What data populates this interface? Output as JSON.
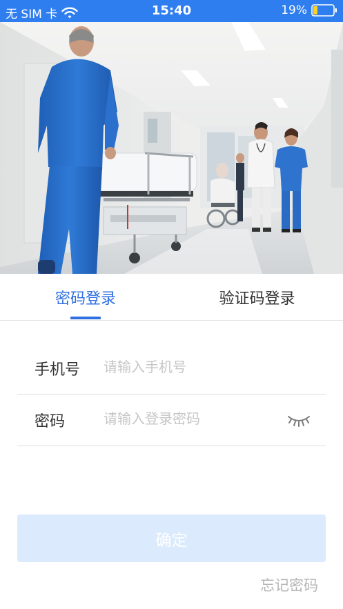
{
  "status_bar": {
    "carrier": "无 SIM 卡",
    "time": "15:40",
    "battery": "19%",
    "icons": [
      "wifi-icon",
      "battery-icon"
    ],
    "color": "#2f7ef0"
  },
  "hero": {
    "icon": "hospital-corridor-photo"
  },
  "tabs": {
    "password_login": "密码登录",
    "code_login": "验证码登录",
    "active": "password_login",
    "accent_color": "#2f6fe0"
  },
  "form": {
    "phone": {
      "label": "手机号",
      "placeholder": "请输入手机号",
      "value": ""
    },
    "password": {
      "label": "密码",
      "placeholder": "请输入登录密码",
      "value": "",
      "toggle_icon": "eye-closed-icon"
    }
  },
  "confirm_button": {
    "label": "确定",
    "background": "#dbeafc"
  },
  "forgot_password": "忘记密码"
}
